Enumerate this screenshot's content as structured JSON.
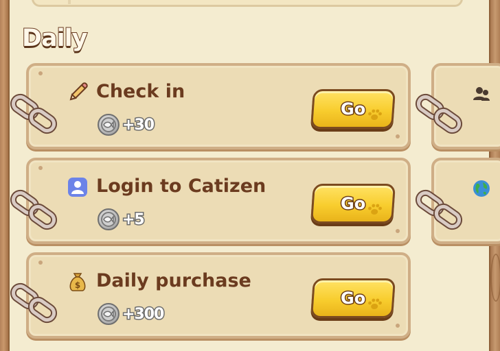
{
  "section": {
    "title": "Daily"
  },
  "tasks": [
    {
      "label": "Check in",
      "icon": "pencil-icon",
      "reward": "+30",
      "button": "Go"
    },
    {
      "label": "Login to Catizen",
      "icon": "user-app-icon",
      "reward": "+5",
      "button": "Go"
    },
    {
      "label": "Daily purchase",
      "icon": "money-bag-icon",
      "reward": "+300",
      "button": "Go"
    }
  ],
  "side_cards": [
    {
      "icon": "people-icon"
    },
    {
      "icon": "globe-icon"
    }
  ],
  "colors": {
    "background": "#f4ecd0",
    "card": "#ecdcb5",
    "card_border": "#cfae86",
    "title_text": "#6b3b1f",
    "go_button": "#f8cd2e",
    "coin": "#b9b9b9"
  }
}
